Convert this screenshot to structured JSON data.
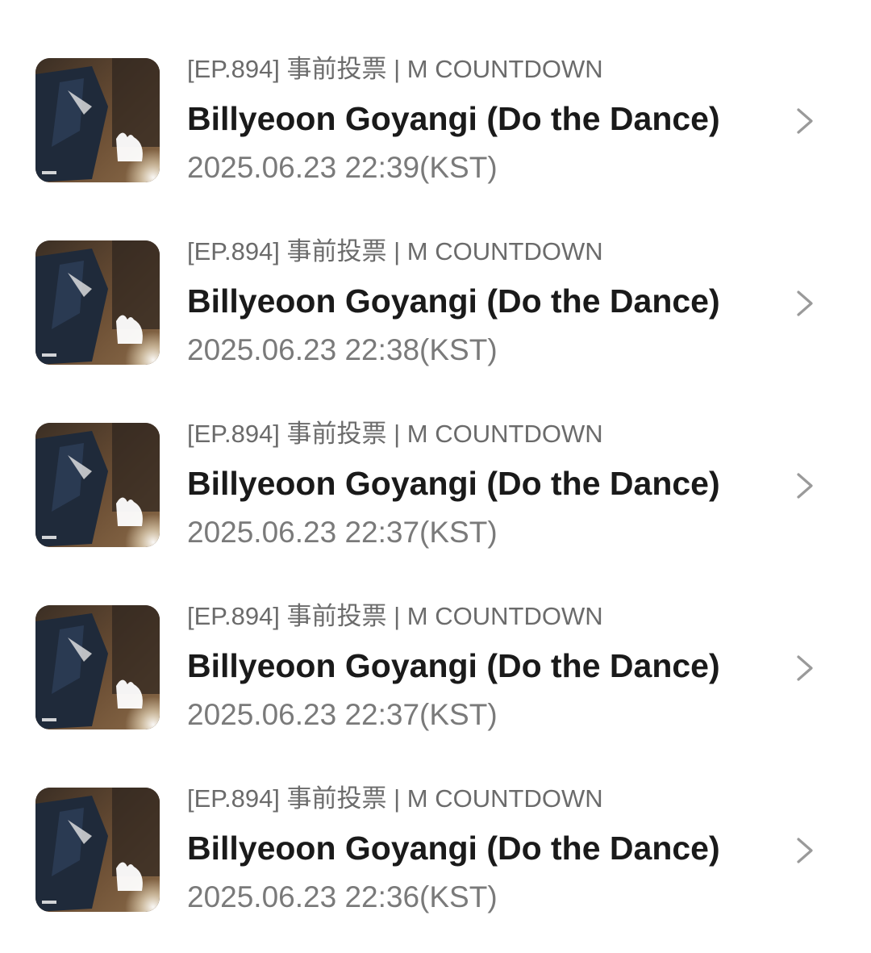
{
  "items": [
    {
      "subtitle": "[EP.894] 事前投票 | M COUNTDOWN",
      "title": "Billyeoon Goyangi (Do the Dance)",
      "date": "2025.06.23 22:39(KST)",
      "thumb_icon": "album-cover-thumbnail",
      "chevron_icon": "chevron-right-icon"
    },
    {
      "subtitle": "[EP.894] 事前投票 | M COUNTDOWN",
      "title": "Billyeoon Goyangi (Do the Dance)",
      "date": "2025.06.23 22:38(KST)",
      "thumb_icon": "album-cover-thumbnail",
      "chevron_icon": "chevron-right-icon"
    },
    {
      "subtitle": "[EP.894] 事前投票 | M COUNTDOWN",
      "title": "Billyeoon Goyangi (Do the Dance)",
      "date": "2025.06.23 22:37(KST)",
      "thumb_icon": "album-cover-thumbnail",
      "chevron_icon": "chevron-right-icon"
    },
    {
      "subtitle": "[EP.894] 事前投票 | M COUNTDOWN",
      "title": "Billyeoon Goyangi (Do the Dance)",
      "date": "2025.06.23 22:37(KST)",
      "thumb_icon": "album-cover-thumbnail",
      "chevron_icon": "chevron-right-icon"
    },
    {
      "subtitle": "[EP.894] 事前投票 | M COUNTDOWN",
      "title": "Billyeoon Goyangi (Do the Dance)",
      "date": "2025.06.23 22:36(KST)",
      "thumb_icon": "album-cover-thumbnail",
      "chevron_icon": "chevron-right-icon"
    }
  ],
  "colors": {
    "background": "#ffffff",
    "title": "#1a1a1a",
    "subtitle": "#6b6b6b",
    "date": "#7a7a7a",
    "chevron": "#9a9a9a"
  }
}
